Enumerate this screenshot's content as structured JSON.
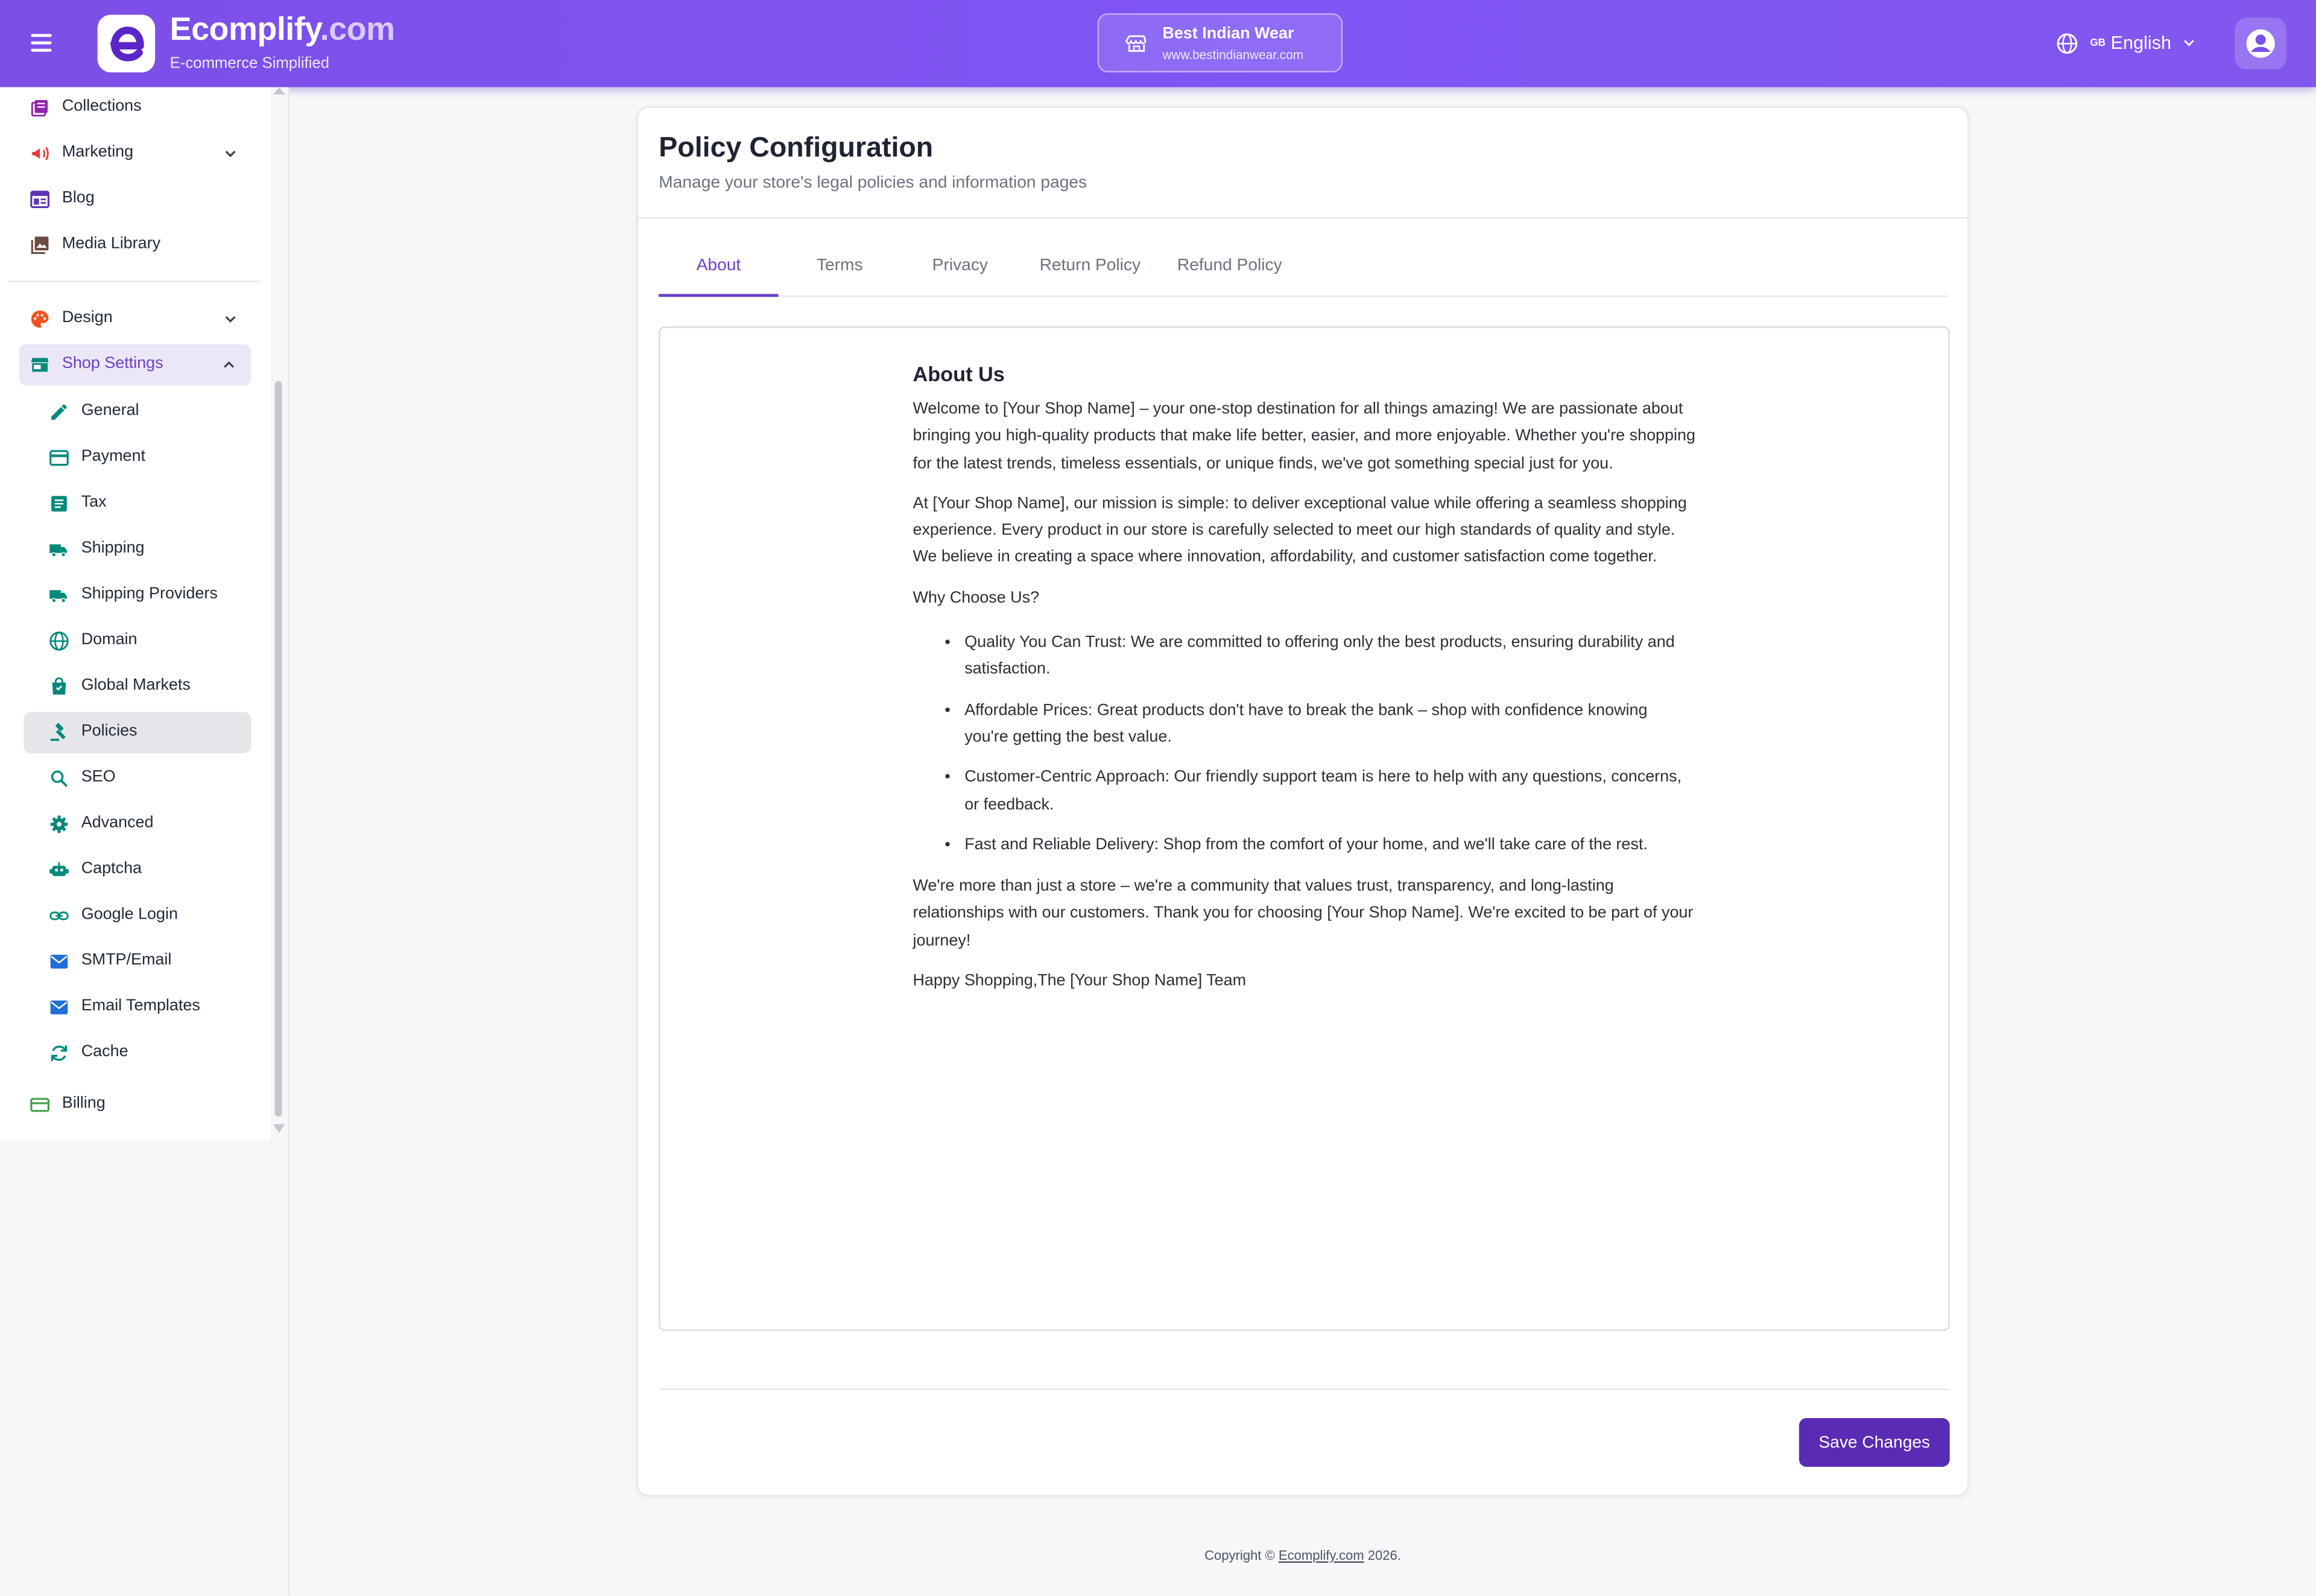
{
  "header": {
    "brand_name": "Ecomplify",
    "brand_suffix": ".com",
    "tagline": "E-commerce Simplified",
    "store_name": "Best Indian Wear",
    "store_url": "www.bestindianwear.com",
    "lang_flag": "GB",
    "lang_label": "English",
    "accent": "#7c4fe6"
  },
  "sidebar": {
    "top_items": [
      {
        "label": "Collections",
        "icon": "collections-icon",
        "color": "#8e24aa"
      },
      {
        "label": "Marketing",
        "icon": "megaphone-icon",
        "color": "#e53935"
      },
      {
        "label": "Blog",
        "icon": "blog-icon",
        "color": "#5e35b1"
      },
      {
        "label": "Media Library",
        "icon": "media-library-icon",
        "color": "#6d4c41"
      }
    ],
    "design": {
      "label": "Design",
      "icon": "palette-icon",
      "color": "#f4511e"
    },
    "shop_settings": {
      "label": "Shop Settings",
      "icon": "store-icon",
      "color": "#00897b"
    },
    "sub_items": [
      {
        "label": "General",
        "icon": "pencil-icon"
      },
      {
        "label": "Payment",
        "icon": "credit-card-icon"
      },
      {
        "label": "Tax",
        "icon": "receipt-icon"
      },
      {
        "label": "Shipping",
        "icon": "truck-icon"
      },
      {
        "label": "Shipping Providers",
        "icon": "truck-icon"
      },
      {
        "label": "Domain",
        "icon": "globe-icon"
      },
      {
        "label": "Global Markets",
        "icon": "shopping-bag-icon"
      },
      {
        "label": "Policies",
        "icon": "gavel-icon"
      },
      {
        "label": "SEO",
        "icon": "search-icon"
      },
      {
        "label": "Advanced",
        "icon": "gear-icon"
      },
      {
        "label": "Captcha",
        "icon": "robot-icon"
      },
      {
        "label": "Google Login",
        "icon": "link-icon"
      },
      {
        "label": "SMTP/Email",
        "icon": "mail-icon"
      },
      {
        "label": "Email Templates",
        "icon": "mail-icon"
      },
      {
        "label": "Cache",
        "icon": "refresh-icon"
      }
    ],
    "billing": {
      "label": "Billing",
      "icon": "billing-card-icon",
      "color": "#43a047"
    },
    "active_item": "Policies"
  },
  "main": {
    "title": "Policy Configuration",
    "subtitle": "Manage your store's legal policies and information pages",
    "tabs": [
      "About",
      "Terms",
      "Privacy",
      "Return Policy",
      "Refund Policy"
    ],
    "active_tab": "About",
    "content": {
      "heading": "About Us",
      "para1": "Welcome to [Your Shop Name] – your one-stop destination for all things amazing! We are passionate about bringing you high-quality products that make life better, easier, and more enjoyable. Whether you're shopping for the latest trends, timeless essentials, or unique finds, we've got something special just for you.",
      "para2": "At [Your Shop Name], our mission is simple: to deliver exceptional value while offering a seamless shopping experience. Every product in our store is carefully selected to meet our high standards of quality and style. We believe in creating a space where innovation, affordability, and customer satisfaction come together.",
      "why": "Why Choose Us?",
      "bullets": [
        "Quality You Can Trust: We are committed to offering only the best products, ensuring durability and satisfaction.",
        "Affordable Prices: Great products don't have to break the bank – shop with confidence knowing you're getting the best value.",
        "Customer-Centric Approach: Our friendly support team is here to help with any questions, concerns, or feedback.",
        "Fast and Reliable Delivery: Shop from the comfort of your home, and we'll take care of the rest."
      ],
      "para3": "We're more than just a store – we're a community that values trust, transparency, and long-lasting relationships with our customers. Thank you for choosing [Your Shop Name]. We're excited to be part of your journey!",
      "signoff": "Happy Shopping,The [Your Shop Name] Team"
    },
    "save_label": "Save Changes",
    "save_color": "#5a2bb5"
  },
  "footer": {
    "prefix": "Copyright © ",
    "link": "Ecomplify.com",
    "suffix": " 2026."
  }
}
